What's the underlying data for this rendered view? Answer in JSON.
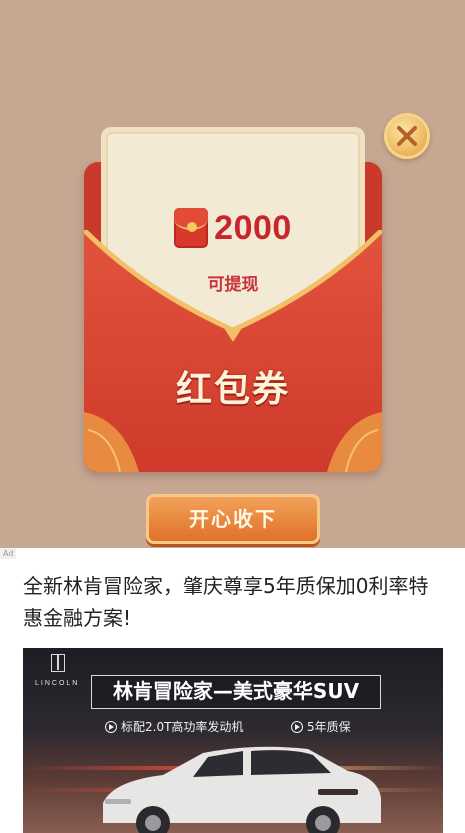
{
  "reward_popup": {
    "amount": "2000",
    "withdraw_text": "可提现",
    "coupon_label": "红包券",
    "accept_label": "开心收下",
    "close_icon": "close-x-icon",
    "envelope_icon": "red-envelope-icon"
  },
  "ad": {
    "tag": "Ad",
    "headline": "全新林肯冒险家，肇庆尊享5年质保加0利率特惠金融方案!",
    "image": {
      "brand": "LINCOLN",
      "title": "林肯冒险家—美式豪华SUV",
      "features": [
        "标配2.0T高功率发动机",
        "5年质保"
      ]
    }
  },
  "colors": {
    "background": "#c6a792",
    "envelope_red": "#d33f2e",
    "amount_red": "#c8262a",
    "button_orange": "#e8823a"
  }
}
